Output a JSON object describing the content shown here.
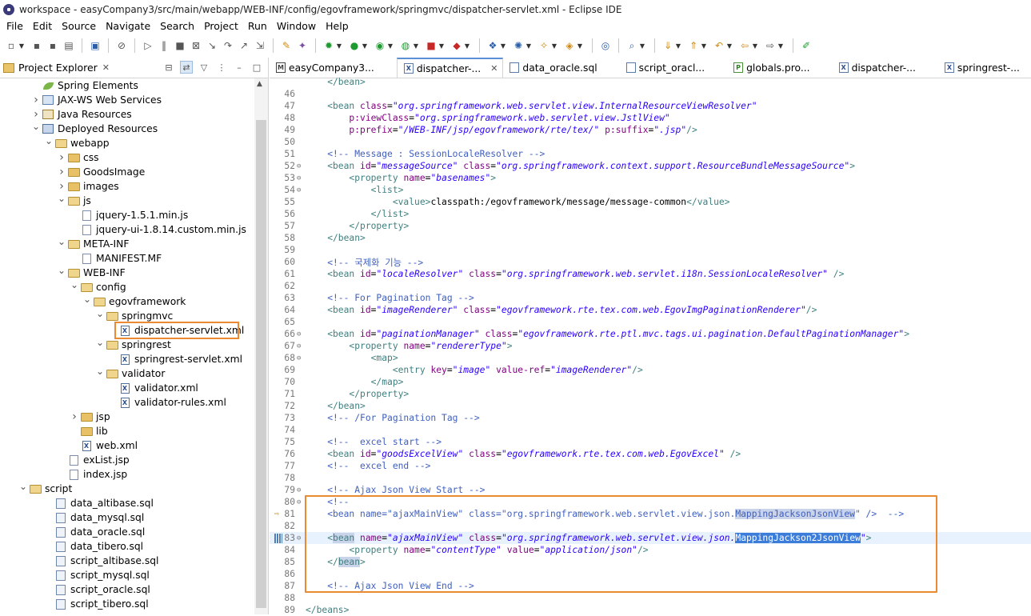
{
  "window": {
    "title": "workspace - easyCompany3/src/main/webapp/WEB-INF/config/egovframework/springmvc/dispatcher-servlet.xml - Eclipse IDE"
  },
  "menu": [
    "File",
    "Edit",
    "Source",
    "Navigate",
    "Search",
    "Project",
    "Run",
    "Window",
    "Help"
  ],
  "project_explorer": {
    "title": "Project Explorer",
    "close": "✕",
    "tree": [
      {
        "label": "Spring Elements",
        "depth": 3,
        "tw": "",
        "icon": "spring-leaf"
      },
      {
        "label": "JAX-WS Web Services",
        "depth": 3,
        "tw": ">",
        "icon": "jaxws"
      },
      {
        "label": "Java Resources",
        "depth": 3,
        "tw": ">",
        "icon": "java-resources"
      },
      {
        "label": "Deployed Resources",
        "depth": 3,
        "tw": "v",
        "icon": "deployed"
      },
      {
        "label": "webapp",
        "depth": 4,
        "tw": "v",
        "icon": "folder-open"
      },
      {
        "label": "css",
        "depth": 5,
        "tw": ">",
        "icon": "folder"
      },
      {
        "label": "GoodsImage",
        "depth": 5,
        "tw": ">",
        "icon": "folder"
      },
      {
        "label": "images",
        "depth": 5,
        "tw": ">",
        "icon": "folder"
      },
      {
        "label": "js",
        "depth": 5,
        "tw": "v",
        "icon": "folder-open"
      },
      {
        "label": "jquery-1.5.1.min.js",
        "depth": 6,
        "tw": "",
        "icon": "file"
      },
      {
        "label": "jquery-ui-1.8.14.custom.min.js",
        "depth": 6,
        "tw": "",
        "icon": "file"
      },
      {
        "label": "META-INF",
        "depth": 5,
        "tw": "v",
        "icon": "folder-open"
      },
      {
        "label": "MANIFEST.MF",
        "depth": 6,
        "tw": "",
        "icon": "file"
      },
      {
        "label": "WEB-INF",
        "depth": 5,
        "tw": "v",
        "icon": "folder-open"
      },
      {
        "label": "config",
        "depth": 6,
        "tw": "v",
        "icon": "folder-open"
      },
      {
        "label": "egovframework",
        "depth": 7,
        "tw": "v",
        "icon": "folder-open"
      },
      {
        "label": "springmvc",
        "depth": 8,
        "tw": "v",
        "icon": "folder-open"
      },
      {
        "label": "dispatcher-servlet.xml",
        "depth": 9,
        "tw": "",
        "icon": "xml"
      },
      {
        "label": "springrest",
        "depth": 8,
        "tw": "v",
        "icon": "folder-open"
      },
      {
        "label": "springrest-servlet.xml",
        "depth": 9,
        "tw": "",
        "icon": "xml"
      },
      {
        "label": "validator",
        "depth": 8,
        "tw": "v",
        "icon": "folder-open"
      },
      {
        "label": "validator.xml",
        "depth": 9,
        "tw": "",
        "icon": "xml"
      },
      {
        "label": "validator-rules.xml",
        "depth": 9,
        "tw": "",
        "icon": "xml"
      },
      {
        "label": "jsp",
        "depth": 6,
        "tw": ">",
        "icon": "folder"
      },
      {
        "label": "lib",
        "depth": 6,
        "tw": "",
        "icon": "folder"
      },
      {
        "label": "web.xml",
        "depth": 6,
        "tw": "",
        "icon": "xml"
      },
      {
        "label": "exList.jsp",
        "depth": 5,
        "tw": "",
        "icon": "file"
      },
      {
        "label": "index.jsp",
        "depth": 5,
        "tw": "",
        "icon": "file"
      },
      {
        "label": "script",
        "depth": 2,
        "tw": "v",
        "icon": "folder-open"
      },
      {
        "label": "data_altibase.sql",
        "depth": 4,
        "tw": "",
        "icon": "sql"
      },
      {
        "label": "data_mysql.sql",
        "depth": 4,
        "tw": "",
        "icon": "sql"
      },
      {
        "label": "data_oracle.sql",
        "depth": 4,
        "tw": "",
        "icon": "sql"
      },
      {
        "label": "data_tibero.sql",
        "depth": 4,
        "tw": "",
        "icon": "sql"
      },
      {
        "label": "script_altibase.sql",
        "depth": 4,
        "tw": "",
        "icon": "sql"
      },
      {
        "label": "script_mysql.sql",
        "depth": 4,
        "tw": "",
        "icon": "sql"
      },
      {
        "label": "script_oracle.sql",
        "depth": 4,
        "tw": "",
        "icon": "sql"
      },
      {
        "label": "script_tibero.sql",
        "depth": 4,
        "tw": "",
        "icon": "sql"
      }
    ]
  },
  "editor_tabs": [
    {
      "label": "easyCompany3...",
      "icon": "M",
      "active": false
    },
    {
      "label": "dispatcher-...",
      "icon": "X",
      "active": true,
      "close": "✕"
    },
    {
      "label": "data_oracle.sql",
      "icon": "S",
      "active": false
    },
    {
      "label": "script_oracl...",
      "icon": "S",
      "active": false
    },
    {
      "label": "globals.pro...",
      "icon": "P",
      "active": false
    },
    {
      "label": "dispatcher-...",
      "icon": "X",
      "active": false
    },
    {
      "label": "springrest-...",
      "icon": "X",
      "active": false
    }
  ],
  "editor_more": "»7",
  "code_lines": [
    {
      "n": "",
      "fold": "",
      "segs": [
        [
          "tag",
          "    </bean>"
        ]
      ]
    },
    {
      "n": "46",
      "fold": "",
      "segs": []
    },
    {
      "n": "47",
      "fold": "",
      "segs": [
        [
          "tag",
          "    <bean "
        ],
        [
          "attr",
          "class"
        ],
        [
          "text",
          "="
        ],
        [
          "val",
          "\"org.springframework.web.servlet.view.InternalResourceViewResolver\""
        ]
      ]
    },
    {
      "n": "48",
      "fold": "",
      "segs": [
        [
          "attr",
          "        p:viewClass"
        ],
        [
          "text",
          "="
        ],
        [
          "val",
          "\"org.springframework.web.servlet.view.JstlView\""
        ]
      ]
    },
    {
      "n": "49",
      "fold": "",
      "segs": [
        [
          "attr",
          "        p:prefix"
        ],
        [
          "text",
          "="
        ],
        [
          "val",
          "\"/WEB-INF/jsp/egovframework/rte/tex/\""
        ],
        [
          "text",
          " "
        ],
        [
          "attr",
          "p:suffix"
        ],
        [
          "text",
          "="
        ],
        [
          "val",
          "\".jsp\""
        ],
        [
          "tag",
          "/>"
        ]
      ]
    },
    {
      "n": "50",
      "fold": "",
      "segs": []
    },
    {
      "n": "51",
      "fold": "",
      "segs": [
        [
          "com",
          "    <!-- Message : SessionLocaleResolver -->"
        ]
      ]
    },
    {
      "n": "52",
      "fold": "⊖",
      "segs": [
        [
          "tag",
          "    <bean "
        ],
        [
          "attr",
          "id"
        ],
        [
          "text",
          "="
        ],
        [
          "val",
          "\"messageSource\""
        ],
        [
          "text",
          " "
        ],
        [
          "attr",
          "class"
        ],
        [
          "text",
          "="
        ],
        [
          "val",
          "\"org.springframework.context.support.ResourceBundleMessageSource\""
        ],
        [
          "tag",
          ">"
        ]
      ]
    },
    {
      "n": "53",
      "fold": "⊖",
      "segs": [
        [
          "tag",
          "        <property "
        ],
        [
          "attr",
          "name"
        ],
        [
          "text",
          "="
        ],
        [
          "val",
          "\"basenames\""
        ],
        [
          "tag",
          ">"
        ]
      ]
    },
    {
      "n": "54",
      "fold": "⊖",
      "segs": [
        [
          "tag",
          "            <list>"
        ]
      ]
    },
    {
      "n": "55",
      "fold": "",
      "segs": [
        [
          "tag",
          "                <value>"
        ],
        [
          "text",
          "classpath:/egovframework/message/message-common"
        ],
        [
          "tag",
          "</value>"
        ]
      ]
    },
    {
      "n": "56",
      "fold": "",
      "segs": [
        [
          "tag",
          "            </list>"
        ]
      ]
    },
    {
      "n": "57",
      "fold": "",
      "segs": [
        [
          "tag",
          "        </property>"
        ]
      ]
    },
    {
      "n": "58",
      "fold": "",
      "segs": [
        [
          "tag",
          "    </bean>"
        ]
      ]
    },
    {
      "n": "59",
      "fold": "",
      "segs": []
    },
    {
      "n": "60",
      "fold": "",
      "segs": [
        [
          "com",
          "    <!-- 국제화 기능 -->"
        ]
      ]
    },
    {
      "n": "61",
      "fold": "",
      "segs": [
        [
          "tag",
          "    <bean "
        ],
        [
          "attr",
          "id"
        ],
        [
          "text",
          "="
        ],
        [
          "val",
          "\"localeResolver\""
        ],
        [
          "text",
          " "
        ],
        [
          "attr",
          "class"
        ],
        [
          "text",
          "="
        ],
        [
          "val",
          "\"org.springframework.web.servlet.i18n.SessionLocaleResolver\""
        ],
        [
          "tag",
          " />"
        ]
      ]
    },
    {
      "n": "62",
      "fold": "",
      "segs": []
    },
    {
      "n": "63",
      "fold": "",
      "segs": [
        [
          "com",
          "    <!-- For Pagination Tag -->"
        ]
      ]
    },
    {
      "n": "64",
      "fold": "",
      "segs": [
        [
          "tag",
          "    <bean "
        ],
        [
          "attr",
          "id"
        ],
        [
          "text",
          "="
        ],
        [
          "val",
          "\"imageRenderer\""
        ],
        [
          "text",
          " "
        ],
        [
          "attr",
          "class"
        ],
        [
          "text",
          "="
        ],
        [
          "val",
          "\"egovframework.rte.tex.com.web.EgovImgPaginationRenderer\""
        ],
        [
          "tag",
          "/>"
        ]
      ]
    },
    {
      "n": "65",
      "fold": "",
      "segs": []
    },
    {
      "n": "66",
      "fold": "⊖",
      "segs": [
        [
          "tag",
          "    <bean "
        ],
        [
          "attr",
          "id"
        ],
        [
          "text",
          "="
        ],
        [
          "val",
          "\"paginationManager\""
        ],
        [
          "text",
          " "
        ],
        [
          "attr",
          "class"
        ],
        [
          "text",
          "="
        ],
        [
          "val",
          "\"egovframework.rte.ptl.mvc.tags.ui.pagination.DefaultPaginationManager\""
        ],
        [
          "tag",
          ">"
        ]
      ]
    },
    {
      "n": "67",
      "fold": "⊖",
      "segs": [
        [
          "tag",
          "        <property "
        ],
        [
          "attr",
          "name"
        ],
        [
          "text",
          "="
        ],
        [
          "val",
          "\"rendererType\""
        ],
        [
          "tag",
          ">"
        ]
      ]
    },
    {
      "n": "68",
      "fold": "⊖",
      "segs": [
        [
          "tag",
          "            <map>"
        ]
      ]
    },
    {
      "n": "69",
      "fold": "",
      "segs": [
        [
          "tag",
          "                <entry "
        ],
        [
          "attr",
          "key"
        ],
        [
          "text",
          "="
        ],
        [
          "val",
          "\"image\""
        ],
        [
          "text",
          " "
        ],
        [
          "attr",
          "value-ref"
        ],
        [
          "text",
          "="
        ],
        [
          "val",
          "\"imageRenderer\""
        ],
        [
          "tag",
          "/>"
        ]
      ]
    },
    {
      "n": "70",
      "fold": "",
      "segs": [
        [
          "tag",
          "            </map>"
        ]
      ]
    },
    {
      "n": "71",
      "fold": "",
      "segs": [
        [
          "tag",
          "        </property>"
        ]
      ]
    },
    {
      "n": "72",
      "fold": "",
      "segs": [
        [
          "tag",
          "    </bean>"
        ]
      ]
    },
    {
      "n": "73",
      "fold": "",
      "segs": [
        [
          "com",
          "    <!-- /For Pagination Tag -->"
        ]
      ]
    },
    {
      "n": "74",
      "fold": "",
      "segs": []
    },
    {
      "n": "75",
      "fold": "",
      "segs": [
        [
          "com",
          "    <!--  excel start -->"
        ]
      ]
    },
    {
      "n": "76",
      "fold": "",
      "segs": [
        [
          "tag",
          "    <bean "
        ],
        [
          "attr",
          "id"
        ],
        [
          "text",
          "="
        ],
        [
          "val",
          "\"goodsExcelView\""
        ],
        [
          "text",
          " "
        ],
        [
          "attr",
          "class"
        ],
        [
          "text",
          "="
        ],
        [
          "val",
          "\"egovframework.rte.tex.com.web.EgovExcel\""
        ],
        [
          "tag",
          " />"
        ]
      ]
    },
    {
      "n": "77",
      "fold": "",
      "segs": [
        [
          "com",
          "    <!--  excel end -->"
        ]
      ]
    },
    {
      "n": "78",
      "fold": "",
      "segs": []
    },
    {
      "n": "79",
      "fold": "⊖",
      "segs": [
        [
          "com",
          "    <!-- Ajax Json View Start -->"
        ]
      ]
    },
    {
      "n": "80",
      "fold": "⊖",
      "segs": [
        [
          "com",
          "    <!--"
        ]
      ]
    },
    {
      "n": "81",
      "fold": "",
      "marker": "arrow",
      "segs": [
        [
          "com",
          "    <bean name=\"ajaxMainView\" class=\"org.springframework.web.servlet.view.json."
        ],
        [
          "comhl",
          "MappingJacksonJsonView"
        ],
        [
          "com",
          "\" />  -->"
        ]
      ]
    },
    {
      "n": "82",
      "fold": "",
      "segs": []
    },
    {
      "n": "83",
      "fold": "⊖",
      "marker": "block",
      "hl": true,
      "segs": [
        [
          "tag",
          "    <"
        ],
        [
          "taghl",
          "bean"
        ],
        [
          "text",
          " "
        ],
        [
          "attr",
          "name"
        ],
        [
          "text",
          "="
        ],
        [
          "val",
          "\"ajaxMainView\""
        ],
        [
          "text",
          " "
        ],
        [
          "attr",
          "class"
        ],
        [
          "text",
          "="
        ],
        [
          "val",
          "\"org.springframework.web.servlet.view.json."
        ],
        [
          "valsel",
          "MappingJackson2JsonView"
        ],
        [
          "val",
          "\""
        ],
        [
          "tag",
          ">"
        ]
      ]
    },
    {
      "n": "84",
      "fold": "",
      "segs": [
        [
          "tag",
          "        <property "
        ],
        [
          "attr",
          "name"
        ],
        [
          "text",
          "="
        ],
        [
          "val",
          "\"contentType\""
        ],
        [
          "text",
          " "
        ],
        [
          "attr",
          "value"
        ],
        [
          "text",
          "="
        ],
        [
          "val",
          "\"application/json\""
        ],
        [
          "tag",
          "/>"
        ]
      ]
    },
    {
      "n": "85",
      "fold": "",
      "segs": [
        [
          "tag",
          "    </"
        ],
        [
          "taghl",
          "bean"
        ],
        [
          "tag",
          ">"
        ]
      ]
    },
    {
      "n": "86",
      "fold": "",
      "segs": []
    },
    {
      "n": "87",
      "fold": "",
      "segs": [
        [
          "com",
          "    <!-- Ajax Json View End -->"
        ]
      ]
    },
    {
      "n": "88",
      "fold": "",
      "segs": []
    },
    {
      "n": "89",
      "fold": "",
      "segs": [
        [
          "tag",
          "</beans>"
        ]
      ]
    }
  ]
}
